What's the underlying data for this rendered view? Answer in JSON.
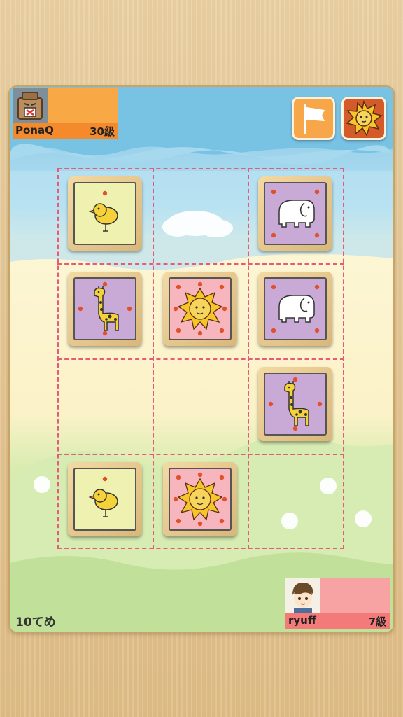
{
  "opponent": {
    "name": "PonaQ",
    "rank": "30級"
  },
  "player": {
    "name": "ryuff",
    "rank": "7級"
  },
  "turn_label": "10てめ",
  "buttons": {
    "resign": "flag-icon",
    "lion_button": "lion-icon"
  },
  "colors": {
    "opponent": "#f58a2c",
    "player": "#f47a7a",
    "grid": "#e75a78"
  },
  "board": {
    "rows": 4,
    "cols": 3,
    "pieces": [
      {
        "row": 0,
        "col": 0,
        "type": "chick",
        "owner": "opponent"
      },
      {
        "row": 0,
        "col": 2,
        "type": "elephant",
        "owner": "opponent"
      },
      {
        "row": 1,
        "col": 0,
        "type": "giraffe",
        "owner": "opponent"
      },
      {
        "row": 1,
        "col": 1,
        "type": "lion",
        "owner": "opponent"
      },
      {
        "row": 1,
        "col": 2,
        "type": "elephant",
        "owner": "player"
      },
      {
        "row": 2,
        "col": 2,
        "type": "giraffe",
        "owner": "player"
      },
      {
        "row": 3,
        "col": 0,
        "type": "chick",
        "owner": "player"
      },
      {
        "row": 3,
        "col": 1,
        "type": "lion",
        "owner": "player"
      }
    ]
  }
}
